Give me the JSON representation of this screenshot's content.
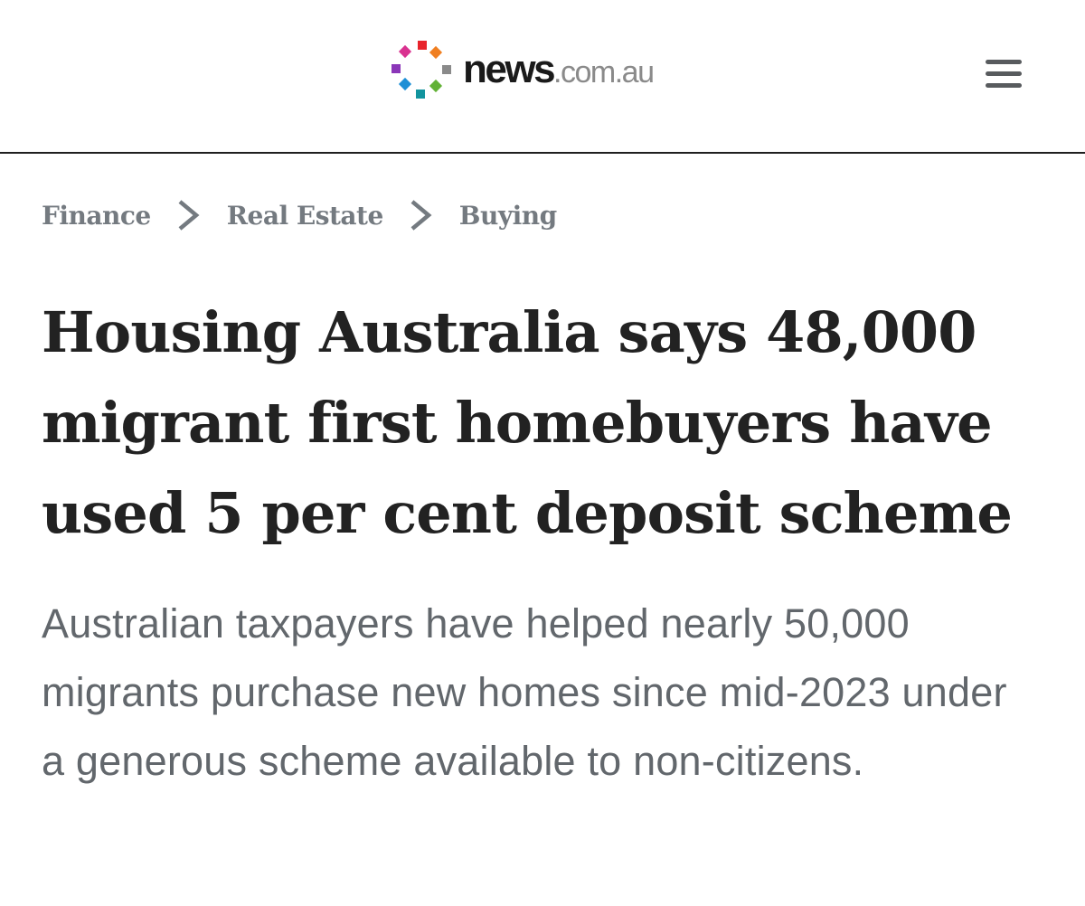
{
  "header": {
    "logo": {
      "brand": "news",
      "domain": ".com.au"
    },
    "menu_icon": "hamburger-menu-icon"
  },
  "breadcrumb": {
    "items": [
      {
        "label": "Finance"
      },
      {
        "label": "Real Estate"
      },
      {
        "label": "Buying"
      }
    ],
    "separator_icon": "chevron-right-icon"
  },
  "article": {
    "headline": "Housing Australia says 48,000 migrant first homebuyers have used 5 per cent deposit scheme",
    "standfirst": "Australian taxpayers have helped nearly 50,000 migrants purchase new homes since mid-2023 under a generous scheme available to non-citizens."
  },
  "colors": {
    "header_rule": "#1f1f1f",
    "breadcrumb_text": "#747a80",
    "headline_text": "#222222",
    "standfirst_text": "#62676c",
    "logo_domain": "#8a8a8a",
    "logo_dots": [
      "#e8232b",
      "#f07f21",
      "#8a8a8a",
      "#62b236",
      "#12949e",
      "#1d8fd6",
      "#8b36b8",
      "#d93290"
    ]
  }
}
